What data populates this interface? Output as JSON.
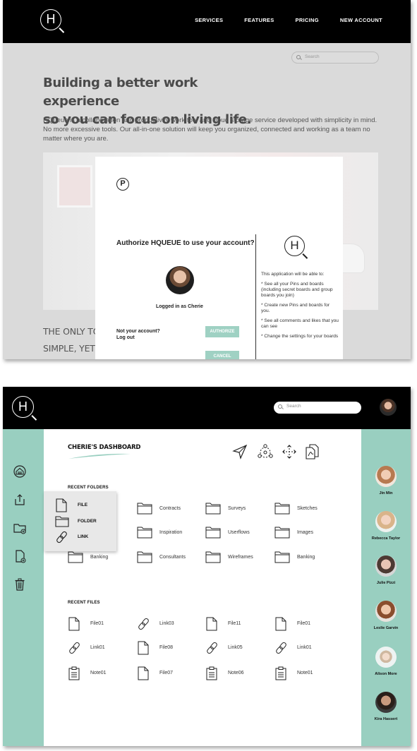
{
  "landing": {
    "logo_text": "H",
    "nav": [
      "SERVICES",
      "FEATURES",
      "PRICING",
      "NEW ACCOUNT"
    ],
    "search_placeholder": "Search",
    "hero_title_1": "Building a better work experience",
    "hero_title_2": "so you can focus on living life.",
    "hero_body": "HQueue is a collaboration and productivity work tool and cloud storage service developed with simplicity in mind. No more excessive tools. Our all-in-one solution will keep you organized, connected and working as a team no matter where you are.",
    "teaser_1": "THE ONLY TOO",
    "teaser_2": "SIMPLE, YET E",
    "modal": {
      "pinterest_glyph": "P",
      "auth_title": "Authorize HQUEUE to use your account?",
      "logged_in": "Logged in as Cherie",
      "not_account": "Not your account?",
      "logout": "Log out",
      "authorize": "AUTHORIZE",
      "cancel": "CANCEL",
      "logo_text": "H",
      "perm_intro": "This application will be able to:",
      "perms": [
        "* See all your Pins and boards (including secret boards and group boards you join)",
        "* Create new Pins and boards for you.",
        "* See all comments and likes that you can see",
        "* Change the settings for your boards"
      ]
    }
  },
  "dashboard": {
    "logo_text": "H",
    "search_placeholder": "Search",
    "title": "CHERIE'S DASHBOARD",
    "recent_folders_label": "RECENT FOLDERS",
    "recent_files_label": "RECENT FILES",
    "popup": [
      "FILE",
      "FOLDER",
      "LINK"
    ],
    "folders": [
      [
        "",
        "Contracts",
        "Surveys",
        "Sketches"
      ],
      [
        "",
        "Inspiration",
        "Userflows",
        "Images"
      ],
      [
        "Banking",
        "Consultants",
        "Wireframes",
        "Banking"
      ]
    ],
    "files": [
      [
        {
          "type": "file",
          "name": "File01"
        },
        {
          "type": "link",
          "name": "Link03"
        },
        {
          "type": "file",
          "name": "File11"
        },
        {
          "type": "file",
          "name": "File01"
        }
      ],
      [
        {
          "type": "link",
          "name": "Link01"
        },
        {
          "type": "file",
          "name": "File08"
        },
        {
          "type": "link",
          "name": "Link05"
        },
        {
          "type": "link",
          "name": "Link01"
        }
      ],
      [
        {
          "type": "note",
          "name": "Note01"
        },
        {
          "type": "file",
          "name": "File07"
        },
        {
          "type": "note",
          "name": "Note06"
        },
        {
          "type": "note",
          "name": "Note01"
        }
      ]
    ],
    "people": [
      "Jin Min",
      "Rebecca Taylor",
      "Julie Pizzi",
      "Leslie Garvin",
      "Alison More",
      "Kira Hassert"
    ],
    "colors": {
      "accent": "#99cfc0",
      "button": "#9fd1c3",
      "nav": "#000000"
    }
  }
}
